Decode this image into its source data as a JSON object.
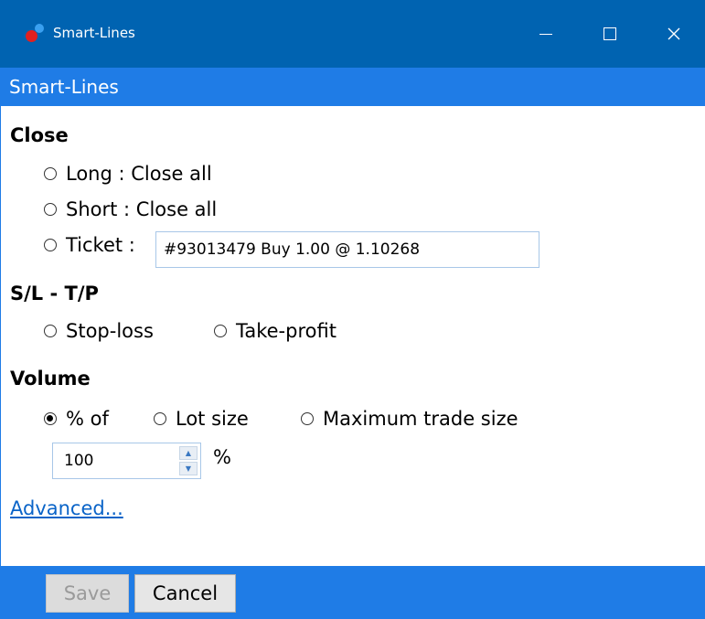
{
  "window": {
    "title": "Smart-Lines"
  },
  "header": {
    "title": "Smart-Lines"
  },
  "close": {
    "label": "Close",
    "options": [
      {
        "label": "Long : Close all",
        "checked": false
      },
      {
        "label": "Short : Close all",
        "checked": false
      },
      {
        "label": "Ticket :",
        "checked": false
      }
    ],
    "ticket_value": "#93013479 Buy 1.00 @ 1.10268"
  },
  "sltp": {
    "label": "S/L - T/P",
    "options": [
      {
        "label": "Stop-loss",
        "checked": false
      },
      {
        "label": "Take-profit",
        "checked": false
      }
    ]
  },
  "volume": {
    "label": "Volume",
    "options": [
      {
        "label": "% of",
        "checked": true
      },
      {
        "label": "Lot size",
        "checked": false
      },
      {
        "label": "Maximum trade size",
        "checked": false
      }
    ],
    "value": "100",
    "unit": "%"
  },
  "advanced_link": "Advanced...",
  "footer": {
    "save_label": "Save",
    "cancel_label": "Cancel"
  },
  "colors": {
    "titlebar": "#0063b1",
    "accent": "#1f7ce6",
    "link": "#0a64c8"
  }
}
